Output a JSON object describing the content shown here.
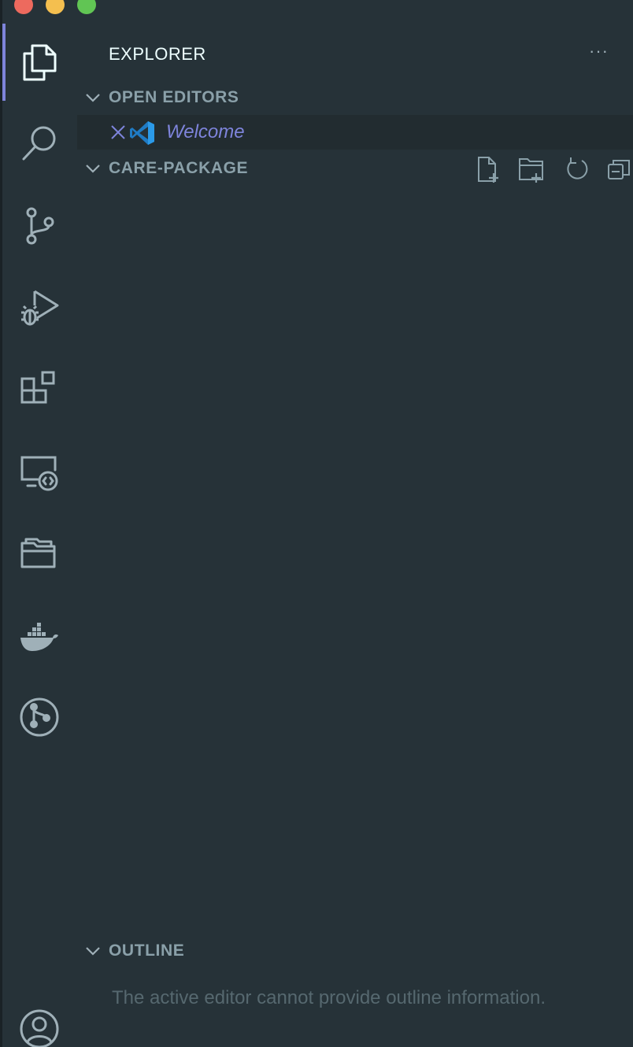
{
  "window": {
    "traffic_lights": [
      "close",
      "minimize",
      "maximize"
    ]
  },
  "colors": {
    "background": "#263238",
    "accent": "#7e84db",
    "section_header_text": "#8aa0a9",
    "muted_text": "#56686f",
    "selected_row": "#222c30",
    "icon": "#9fb0b8",
    "vscode_blue": "#2b8fd9"
  },
  "activity_bar": {
    "active": "explorer",
    "items": [
      {
        "id": "explorer",
        "icon": "files-icon"
      },
      {
        "id": "search",
        "icon": "search-icon"
      },
      {
        "id": "source-control",
        "icon": "source-control-icon"
      },
      {
        "id": "run-debug",
        "icon": "run-debug-icon"
      },
      {
        "id": "extensions",
        "icon": "extensions-icon"
      },
      {
        "id": "remote-explorer",
        "icon": "remote-explorer-icon"
      },
      {
        "id": "project-manager",
        "icon": "folder-icon"
      },
      {
        "id": "docker",
        "icon": "docker-icon"
      },
      {
        "id": "gitlens",
        "icon": "gitlens-icon"
      },
      {
        "id": "accounts",
        "icon": "account-icon"
      }
    ]
  },
  "sidebar": {
    "title": "EXPLORER",
    "more_actions": "···",
    "open_editors": {
      "label": "OPEN EDITORS",
      "items": [
        {
          "name": "Welcome",
          "icon": "vscode-logo-icon",
          "close_icon": "close-icon"
        }
      ]
    },
    "folder": {
      "label": "CARE-PACKAGE",
      "actions": [
        "new-file-icon",
        "new-folder-icon",
        "refresh-icon",
        "collapse-all-icon"
      ]
    },
    "outline": {
      "label": "OUTLINE",
      "message": "The active editor cannot provide outline information."
    }
  }
}
